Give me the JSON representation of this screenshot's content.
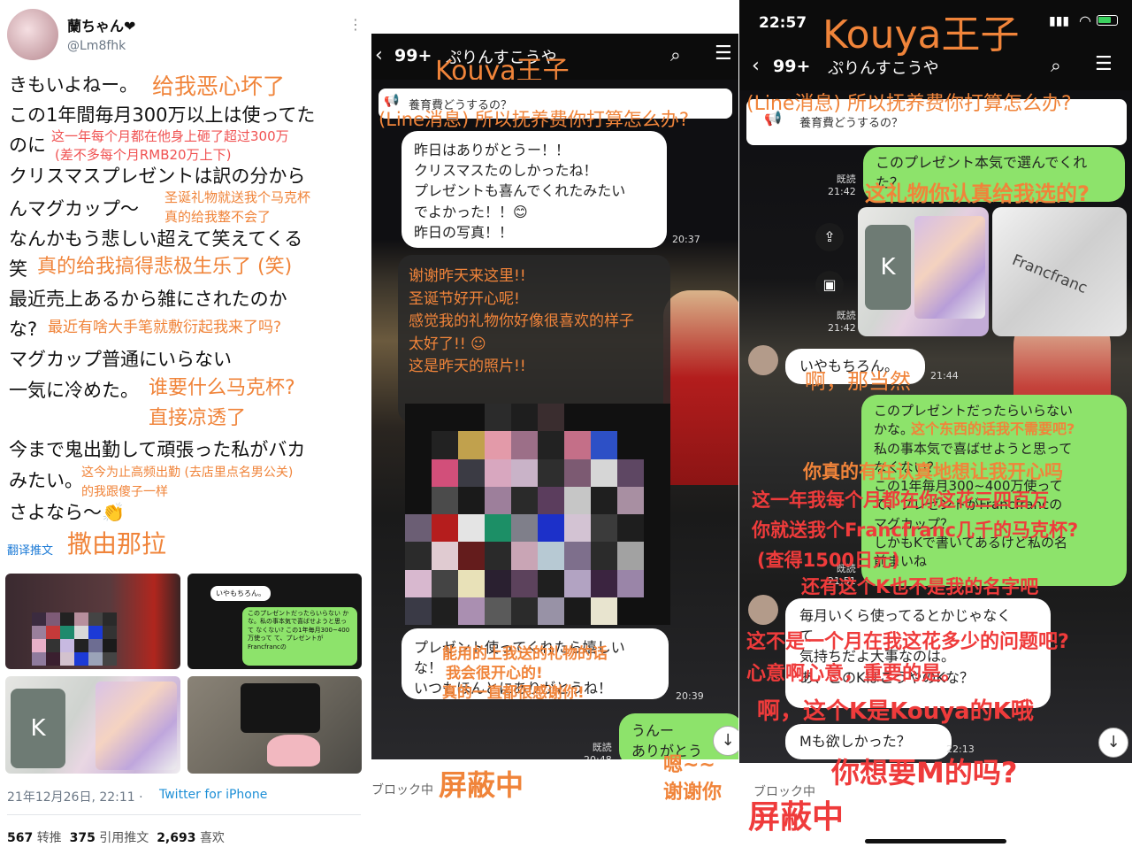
{
  "tweet": {
    "display_name": "蘭ちゃん❤",
    "handle": "@Lm8fhk",
    "jp_lines": [
      "きもいよねー。",
      "この1年間毎月300万以上は使ってた",
      "のに",
      "クリスマスプレゼントは訳の分から",
      "んマグカップ〜",
      "なんかもう悲しい超えて笑えてくる",
      "笑",
      "最近売上あるから雑にされたのか",
      "な?",
      "マグカップ普通にいらない",
      "一気に冷めた。",
      "今まで鬼出勤して頑張った私がバカ",
      "みたい。",
      "さよなら〜👏"
    ],
    "cn_notes": [
      "给我恶心坏了",
      "这一年每个月都在他身上砸了超过300万",
      "(差不多每个月RMB20万上下)",
      "圣诞礼物就送我个马克杯",
      "真的给我整不会了",
      "真的给我搞得悲极生乐了 (笑)",
      "最近有啥大手笔就敷衍起我来了吗?",
      "谁要什么马克杯?",
      "直接凉透了",
      "这今为止高频出勤 (去店里点名男公关)",
      "的我跟傻子一样",
      "撒由那拉"
    ],
    "translate_label": "翻译推文",
    "timestamp": "21年12月26日, 22:11 ·",
    "source": "Twitter for iPhone",
    "retweets_count": "567",
    "retweets_label": "转推",
    "quotes_count": "375",
    "quotes_label": "引用推文",
    "likes_count": "2,693",
    "likes_label": "喜欢",
    "thumb_texts": [
      "いやもちろん。",
      "このプレゼントだったらいらない かな。私の事本気で喜ばせようと思って なくない? この1年毎月300~400万使って て、プレゼントがFrancfrancの"
    ]
  },
  "chat1": {
    "unread": "99+",
    "contact": "ぷりんすこうや",
    "overlay_name": "Kouya王子",
    "notice_text": "養育費どうするの？",
    "notice_cn": "(Line消息) 所以抚养费你打算怎么办?",
    "bubble1": [
      "昨日はありがとうー！！",
      "クリスマスたのしかったね！",
      "プレゼントも喜んでくれたみたい",
      "でよかった！！😊",
      "昨日の写真！！"
    ],
    "bubble1_time": "20:37",
    "cn_trans1": [
      "谢谢昨天来这里!!",
      "圣诞节好开心呢!",
      "感觉我的礼物你好像很喜欢的样子",
      "太好了!! ☺",
      "这是昨天的照片!!"
    ],
    "bubble2": [
      "プレゼント使ってくれたら嬉しい",
      "な！",
      "いつもほんとにありがとうね！"
    ],
    "bubble2_time": "20:39",
    "cn_trans2": [
      "能用的上我送的礼物的话",
      "我会很开心的!",
      "真的一直都很感谢你!"
    ],
    "read_label": "既読",
    "read_time": "20:48",
    "green_bubble": [
      "うんー",
      "ありがとう"
    ],
    "cn_reply": [
      "嗯~~",
      "谢谢你"
    ],
    "block_label": "ブロック中",
    "block_cn": "屏蔽中"
  },
  "chat2": {
    "status_time": "22:57",
    "unread": "99+",
    "contact": "ぷりんすこうや",
    "overlay_name": "Kouya王子",
    "notice_text": "養育費どうするの？",
    "notice_cn": "(Line消息) 所以抚养费你打算怎么办?",
    "green1": [
      "このプレゼント本気で選んでくれ",
      "た？"
    ],
    "green1_read": "既読",
    "green1_time": "21:42",
    "cn_g1": "这礼物你认真给我选的?",
    "img_read": "既読",
    "img_time": "21:42",
    "photo_brand": "Francfranc",
    "white1": "いやもちろん。",
    "white1_time": "21:44",
    "cn_w1": "啊，那当然",
    "green2": [
      "このプレゼントだったらいらない",
      "かな。",
      "私の事本気で喜ばせようと思って",
      "なくない？",
      "この1年毎月300~400万使って",
      "て、プレゼントがFrancfrancの",
      "マグカップ？",
      "しかもKで書いてあるけど私の名",
      "前まいね"
    ],
    "green2_read": "既読",
    "green2_time": "21:51",
    "cn_g2": [
      "这个东西的话我不需要吧?",
      "你真的有在认真地想让我开心吗",
      "这一年我每个月都在你这花三四百万",
      "你就送我个Francfranc几千的马克杯?",
      "(查得1500日元)",
      "还有这个K也不是我的名字吧"
    ],
    "white2": [
      "毎月いくら使ってるとかじゃなく",
      "て",
      "気持ちだよ大事なのは。",
      "あ、このKはこうやのKな？"
    ],
    "cn_w2": [
      "这不是一个月在我这花多少的问题吧?",
      "心意啊心意，重要的是。",
      "啊，这个K是Kouya的K哦"
    ],
    "white3": "Mも欲しかった？",
    "white3_time": "22:13",
    "cn_w3": "你想要M的吗?",
    "block_label": "ブロック中",
    "block_cn": "屏蔽中"
  },
  "colors": {
    "annotation_orange": "#f0843a",
    "annotation_red": "#ef3b3b",
    "line_green": "#8de36b",
    "link_blue": "#1d8fd6"
  }
}
